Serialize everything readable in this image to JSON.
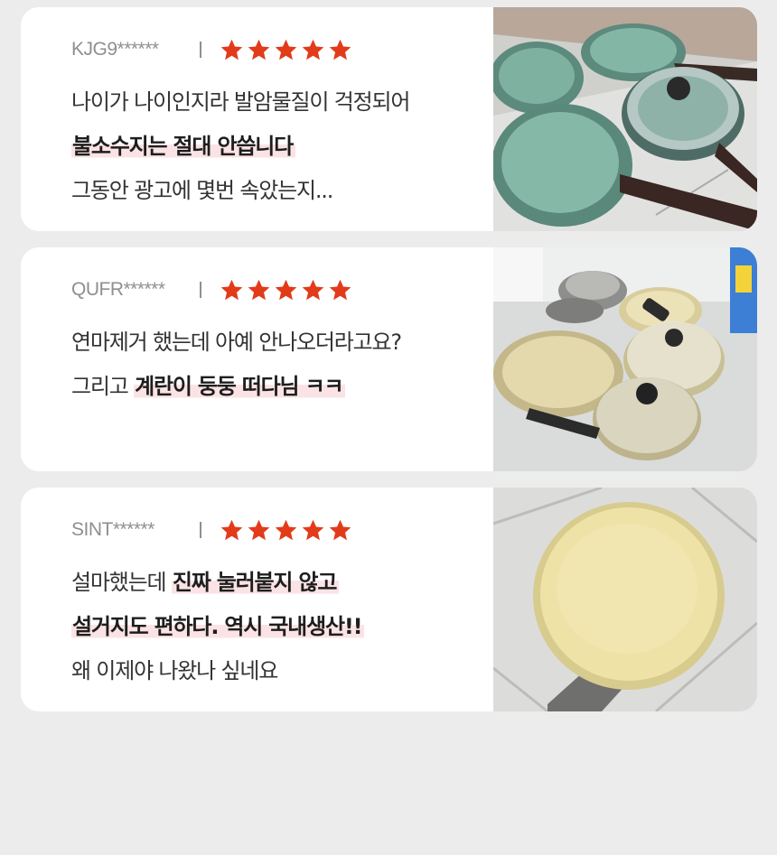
{
  "reviews": [
    {
      "user": "KJG9******",
      "rating": 5,
      "photo_icon": "green-pan-set-photo",
      "lines": [
        {
          "plain": "나이가 나이인지라 발암물질이 걱정되어",
          "highlight": ""
        },
        {
          "plain": "",
          "highlight": "불소수지는 절대 안씁니다"
        },
        {
          "plain": "그동안 광고에 몇번 속았는지...",
          "highlight": ""
        }
      ]
    },
    {
      "user": "QUFR******",
      "rating": 5,
      "photo_icon": "cream-pan-set-photo",
      "lines": [
        {
          "plain": "연마제거 했는데 아예 안나오더라고요?",
          "highlight": ""
        },
        {
          "plain": "그리고 ",
          "highlight": "계란이 둥둥 떠다님 ㅋㅋ"
        }
      ]
    },
    {
      "user": "SINT******",
      "rating": 5,
      "photo_icon": "yellow-frypan-photo",
      "lines": [
        {
          "plain": "설마했는데 ",
          "highlight": "진짜 눌러붙지 않고"
        },
        {
          "plain": "",
          "highlight": "설거지도 편하다. 역시 국내생산!!"
        },
        {
          "plain": "왜 이제야 나왔나 싶네요",
          "highlight": ""
        }
      ]
    }
  ],
  "colors": {
    "star": "#e23b1a",
    "highlight": "#fbe3e5",
    "background": "#ececec"
  }
}
